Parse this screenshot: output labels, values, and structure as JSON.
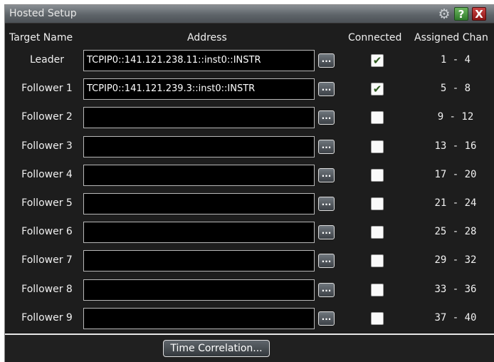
{
  "window": {
    "title": "Hosted Setup",
    "icons": {
      "settings": "gear-icon",
      "help": "help-icon",
      "close": "close-icon"
    },
    "help_label": "?",
    "close_label": "X",
    "settings_glyph": "⚙"
  },
  "headers": {
    "target_name": "Target Name",
    "address": "Address",
    "connected": "Connected",
    "assigned_channels": "Assigned Chan"
  },
  "rows": [
    {
      "name": "Leader",
      "address": "TCPIP0::141.121.238.11::inst0::INSTR",
      "connected": true,
      "channels": "1 - 4",
      "check": "✔"
    },
    {
      "name": "Follower 1",
      "address": "TCPIP0::141.121.239.3::inst0::INSTR",
      "connected": true,
      "channels": "5 - 8",
      "check": "✔"
    },
    {
      "name": "Follower 2",
      "address": "",
      "connected": false,
      "channels": "9 - 12",
      "check": ""
    },
    {
      "name": "Follower 3",
      "address": "",
      "connected": false,
      "channels": "13 - 16",
      "check": ""
    },
    {
      "name": "Follower 4",
      "address": "",
      "connected": false,
      "channels": "17 - 20",
      "check": ""
    },
    {
      "name": "Follower 5",
      "address": "",
      "connected": false,
      "channels": "21 - 24",
      "check": ""
    },
    {
      "name": "Follower 6",
      "address": "",
      "connected": false,
      "channels": "25 - 28",
      "check": ""
    },
    {
      "name": "Follower 7",
      "address": "",
      "connected": false,
      "channels": "29 - 32",
      "check": ""
    },
    {
      "name": "Follower 8",
      "address": "",
      "connected": false,
      "channels": "33 - 36",
      "check": ""
    },
    {
      "name": "Follower 9",
      "address": "",
      "connected": false,
      "channels": "37 - 40",
      "check": ""
    }
  ],
  "browse_label": "...",
  "footer": {
    "time_correlation_label": "Time Correlation..."
  }
}
